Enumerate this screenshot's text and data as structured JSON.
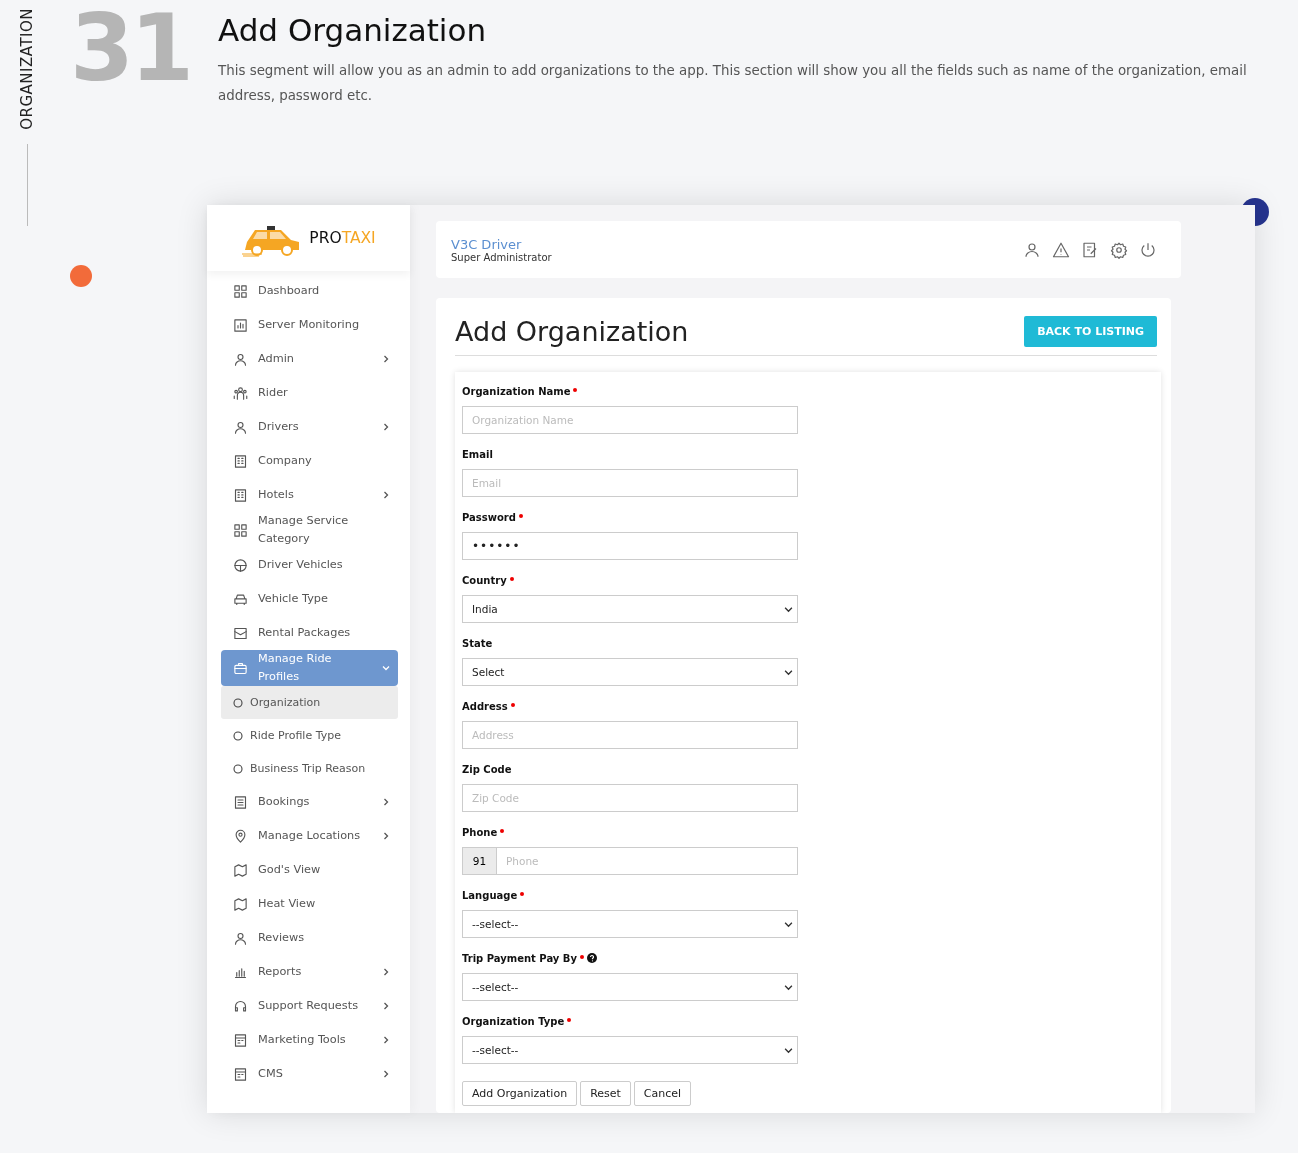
{
  "section": {
    "vertical_label": "ORGANIZATION",
    "number": "31",
    "title": "Add Organization",
    "description": "This segment will allow you as an admin to add organizations to the app. This section will show you all the fields such as name of the organization, email address, password etc."
  },
  "brand": {
    "part_1": "PRO",
    "part_2": "TAXI"
  },
  "sidebar": {
    "items": [
      {
        "kind": "item",
        "label": "Dashboard",
        "has_submenu": false,
        "selected": false
      },
      {
        "kind": "item",
        "label": "Server Monitoring",
        "has_submenu": false,
        "selected": false
      },
      {
        "kind": "item",
        "label": "Admin",
        "has_submenu": true,
        "selected": false
      },
      {
        "kind": "item",
        "label": "Rider",
        "has_submenu": false,
        "selected": false
      },
      {
        "kind": "item",
        "label": "Drivers",
        "has_submenu": true,
        "selected": false
      },
      {
        "kind": "item",
        "label": "Company",
        "has_submenu": false,
        "selected": false
      },
      {
        "kind": "item",
        "label": "Hotels",
        "has_submenu": true,
        "selected": false
      },
      {
        "kind": "item",
        "label": "Manage Service Category",
        "has_submenu": false,
        "selected": false
      },
      {
        "kind": "item",
        "label": "Driver Vehicles",
        "has_submenu": false,
        "selected": false
      },
      {
        "kind": "item",
        "label": "Vehicle Type",
        "has_submenu": false,
        "selected": false
      },
      {
        "kind": "item",
        "label": "Rental Packages",
        "has_submenu": false,
        "selected": false
      },
      {
        "kind": "item",
        "label": "Manage Ride Profiles",
        "has_submenu": true,
        "selected": true,
        "expanded": true,
        "children": [
          {
            "label": "Organization",
            "selected": true
          },
          {
            "label": "Ride Profile Type",
            "selected": false
          },
          {
            "label": "Business Trip Reason",
            "selected": false
          }
        ]
      },
      {
        "kind": "item",
        "label": "Bookings",
        "has_submenu": true,
        "selected": false
      },
      {
        "kind": "item",
        "label": "Manage Locations",
        "has_submenu": true,
        "selected": false
      },
      {
        "kind": "item",
        "label": "God's View",
        "has_submenu": false,
        "selected": false
      },
      {
        "kind": "item",
        "label": "Heat View",
        "has_submenu": false,
        "selected": false
      },
      {
        "kind": "item",
        "label": "Reviews",
        "has_submenu": false,
        "selected": false
      },
      {
        "kind": "item",
        "label": "Reports",
        "has_submenu": true,
        "selected": false
      },
      {
        "kind": "item",
        "label": "Support Requests",
        "has_submenu": true,
        "selected": false
      },
      {
        "kind": "item",
        "label": "Marketing Tools",
        "has_submenu": true,
        "selected": false
      },
      {
        "kind": "item",
        "label": "CMS",
        "has_submenu": true,
        "selected": false
      }
    ]
  },
  "topbar": {
    "user_name": "V3C Driver",
    "user_role": "Super Administrator"
  },
  "page": {
    "title": "Add Organization",
    "back_button": "BACK TO LISTING"
  },
  "form": {
    "fields": [
      {
        "kind": "text",
        "label": "Organization Name",
        "required": true,
        "placeholder": "Organization Name"
      },
      {
        "kind": "text",
        "label": "Email",
        "required": false,
        "placeholder": "Email"
      },
      {
        "kind": "password",
        "label": "Password",
        "required": true,
        "value": "••••••"
      },
      {
        "kind": "select",
        "label": "Country",
        "required": true,
        "value": "India"
      },
      {
        "kind": "select",
        "label": "State",
        "required": false,
        "value": "Select"
      },
      {
        "kind": "text",
        "label": "Address",
        "required": true,
        "placeholder": "Address"
      },
      {
        "kind": "text",
        "label": "Zip Code",
        "required": false,
        "placeholder": "Zip Code"
      },
      {
        "kind": "phone",
        "label": "Phone",
        "required": true,
        "prefix": "91",
        "placeholder": "Phone"
      },
      {
        "kind": "select",
        "label": "Language",
        "required": true,
        "value": "--select--"
      },
      {
        "kind": "select",
        "label": "Trip Payment Pay By",
        "required": true,
        "help": true,
        "value": "--select--"
      },
      {
        "kind": "select",
        "label": "Organization Type",
        "required": true,
        "value": "--select--"
      }
    ],
    "buttons": [
      "Add Organization",
      "Reset",
      "Cancel"
    ]
  }
}
